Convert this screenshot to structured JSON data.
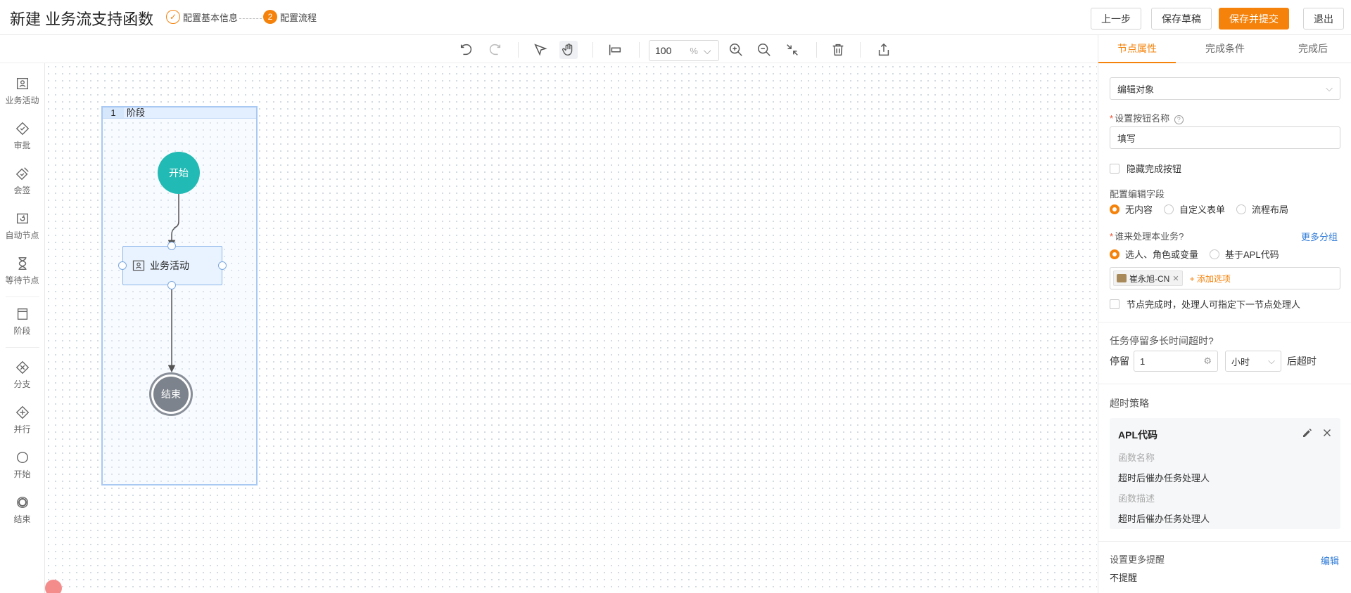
{
  "header": {
    "title": "新建 业务流支持函数",
    "steps": [
      {
        "number": "✓",
        "label": "配置基本信息",
        "state": "done"
      },
      {
        "number": "2",
        "label": "配置流程",
        "state": "active"
      }
    ],
    "buttons": {
      "prev": "上一步",
      "save_draft": "保存草稿",
      "save_submit": "保存并提交",
      "exit": "退出"
    }
  },
  "toolbar": {
    "icons": [
      "undo-icon",
      "redo-icon",
      "select-icon",
      "hand-icon",
      "align-icon",
      "zoom-in-icon",
      "zoom-out-icon",
      "fit-icon",
      "delete-icon",
      "export-icon"
    ],
    "zoom_value": "100",
    "zoom_unit": "%"
  },
  "palette": {
    "items": [
      {
        "label": "业务活动",
        "icon": "user-card-icon"
      },
      {
        "label": "审批",
        "icon": "diamond-check-icon"
      },
      {
        "label": "会签",
        "icon": "diamond-multi-icon"
      },
      {
        "label": "自动节点",
        "icon": "auto-cycle-icon"
      },
      {
        "label": "等待节点",
        "icon": "hourglass-icon"
      },
      {
        "label": "阶段",
        "icon": "stage-icon"
      },
      {
        "label": "分支",
        "icon": "branch-diamond-icon"
      },
      {
        "label": "并行",
        "icon": "parallel-diamond-icon"
      },
      {
        "label": "开始",
        "icon": "circle-icon"
      },
      {
        "label": "结束",
        "icon": "double-circle-icon"
      }
    ]
  },
  "canvas": {
    "stage": {
      "number": "1",
      "label": "阶段"
    },
    "start_node": "开始",
    "activity_node": "业务活动",
    "end_node": "结束"
  },
  "panel": {
    "tabs": [
      "节点属性",
      "完成条件",
      "完成后"
    ],
    "edit_object": "编辑对象",
    "button_name_label": "设置按钮名称",
    "button_name_value": "填写",
    "hide_complete": "隐藏完成按钮",
    "edit_fields_label": "配置编辑字段",
    "edit_fields_options": [
      "无内容",
      "自定义表单",
      "流程布局"
    ],
    "handler_label": "谁来处理本业务?",
    "more_groups": "更多分组",
    "handler_options": [
      "选人、角色或变量",
      "基于APL代码"
    ],
    "handler_tag": "崔永旭-CN",
    "add_option": "+ 添加选项",
    "assign_next": "节点完成时，处理人可指定下一节点处理人",
    "timeout_label": "任务停留多长时间超时?",
    "stay_prefix": "停留",
    "stay_value": "1",
    "stay_unit": "小时",
    "stay_suffix": "后超时",
    "policy_label": "超时策略",
    "policy_card": {
      "title": "APL代码",
      "func_name_key": "函数名称",
      "func_name_value": "超时后催办任务处理人",
      "func_desc_key": "函数描述",
      "func_desc_value": "超时后催办任务处理人"
    },
    "reminder_label": "设置更多提醒",
    "reminder_edit": "编辑",
    "reminder_value": "不提醒"
  },
  "colors": {
    "accent": "#f5820a",
    "start_node": "#22bab4",
    "end_node": "#7d838c",
    "link": "#2f7bd8"
  }
}
